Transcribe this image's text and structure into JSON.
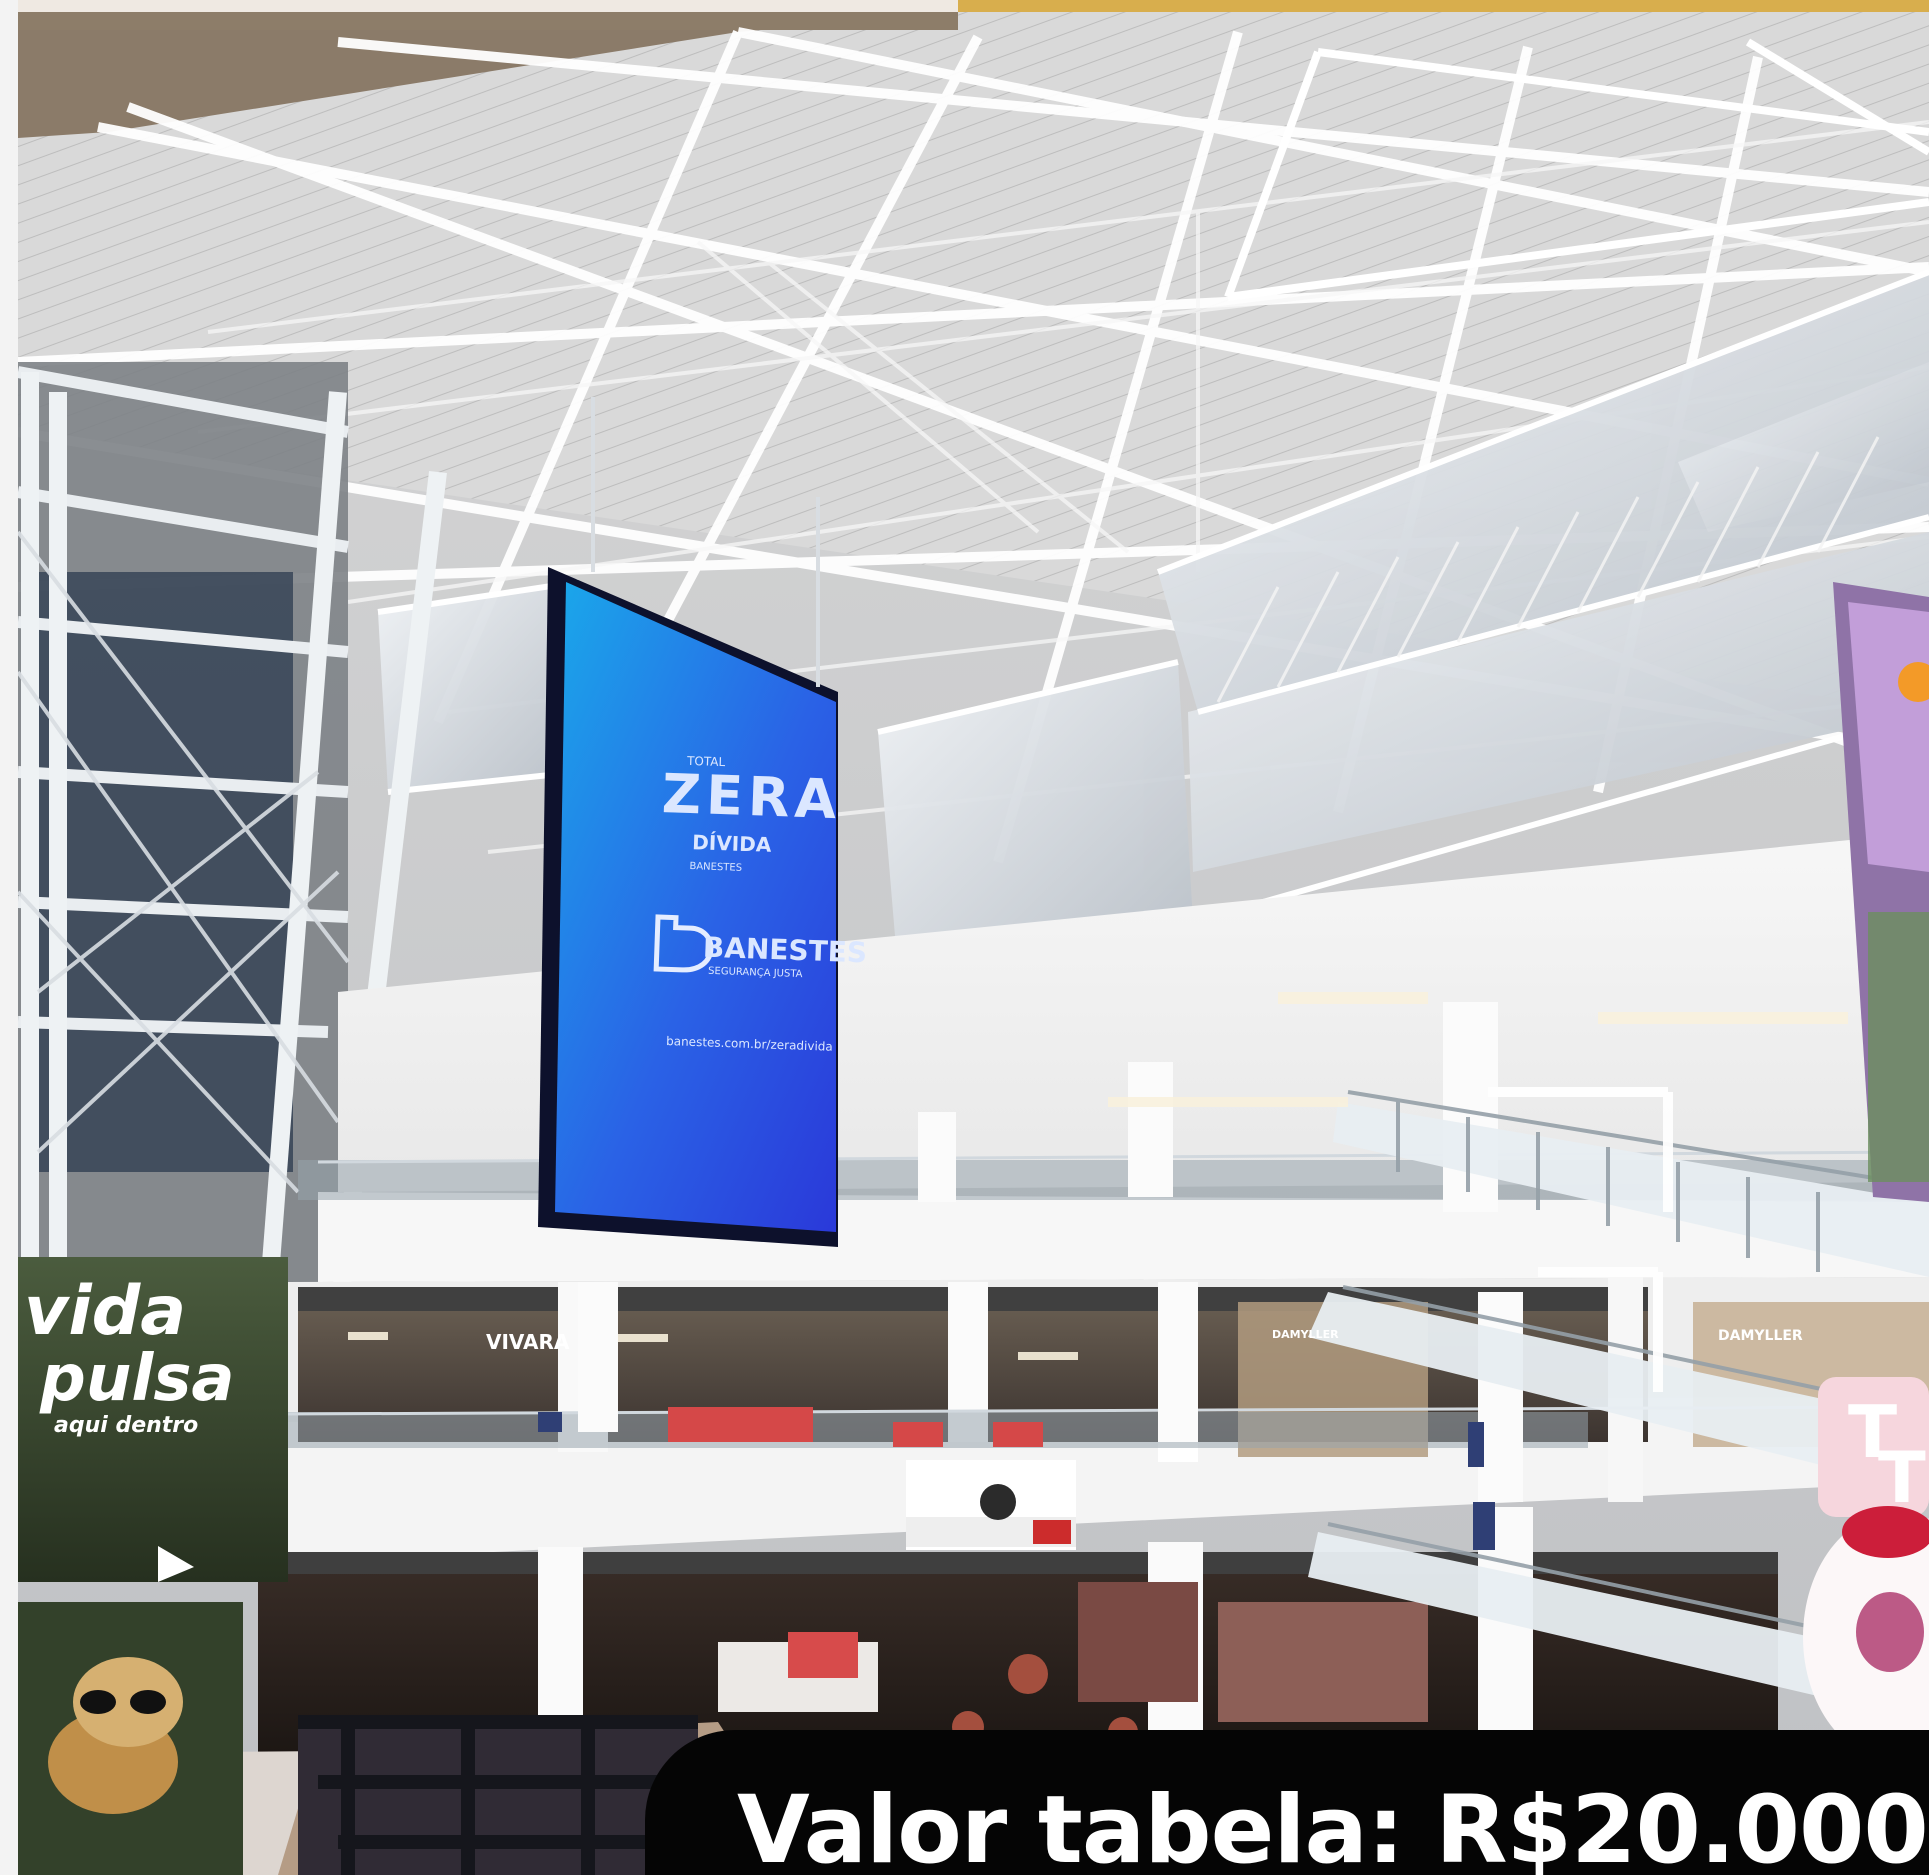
{
  "image": {
    "sign_left": {
      "line1": "vida",
      "line2": "pulsa",
      "line3": "aqui dentro"
    },
    "led_screen": {
      "title_small": "TOTAL",
      "title_main": "ZERA",
      "title_sub": "DÍVIDA",
      "subtitle": "BANESTES",
      "brand": "BANESTES",
      "brand_sub": "SEGURANÇA JUSTA",
      "url": "banestes.com.br/zeradivida"
    },
    "store_sign": "VIVARA",
    "store_sign_right_1": "DAMYLLER",
    "store_sign_right_2": "DAMYLLER",
    "caption": "Valor tabela: R$20.000"
  },
  "colors": {
    "accent_gold": "#d8ae4d",
    "caption_bg": "#050505",
    "screen_blue": "#2a62e6"
  }
}
